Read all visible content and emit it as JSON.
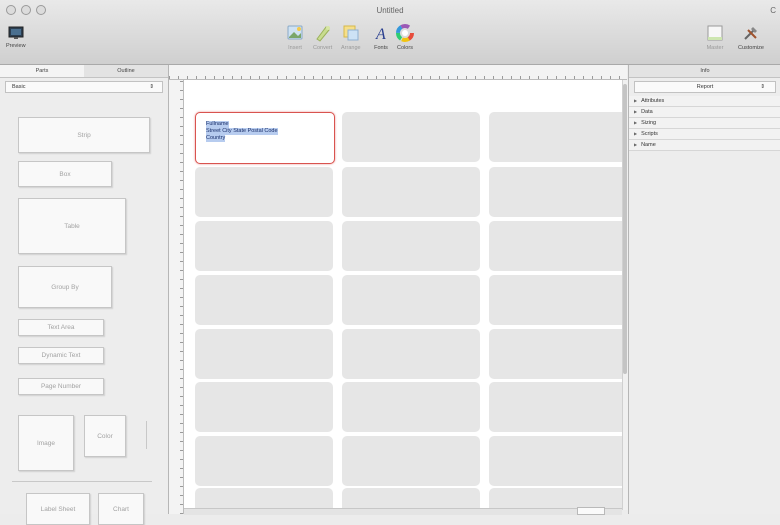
{
  "window": {
    "title": "Untitled",
    "corner_text": "C"
  },
  "toolbar": {
    "preview_label": "Preview",
    "insert_label": "Insert",
    "convert_label": "Convert",
    "arrange_label": "Arrange",
    "fonts_label": "Fonts",
    "colors_label": "Colors",
    "master_label": "Master",
    "customize_label": "Customize"
  },
  "left_panel": {
    "tabs": [
      "Parts",
      "Outline"
    ],
    "active_tab": "Parts",
    "section_select": "Basic",
    "parts": {
      "strip": "Strip",
      "box": "Box",
      "table": "Table",
      "group_by": "Group By",
      "text_area": "Text Area",
      "dynamic_text": "Dynamic Text",
      "page_number": "Page Number",
      "image": "Image",
      "color": "Color",
      "label_sheet": "Label Sheet",
      "chart": "Chart"
    }
  },
  "canvas": {
    "selected_label": {
      "line1": "Fullname",
      "line2": "Street City State Postal Code",
      "line3": "Country"
    },
    "label_grid": {
      "columns": 3,
      "rows": 8
    },
    "selected_color": "#d9534f",
    "highlight_color": "#b7ccef"
  },
  "right_panel": {
    "title": "Info",
    "inspector_select": "Report",
    "sections": [
      "Attributes",
      "Data",
      "Sizing",
      "Scripts",
      "Name"
    ]
  },
  "colors": {
    "toolbar_bg": "#d8d8d8",
    "panel_bg": "#ededed",
    "cell_bg": "#e6e6e6"
  }
}
